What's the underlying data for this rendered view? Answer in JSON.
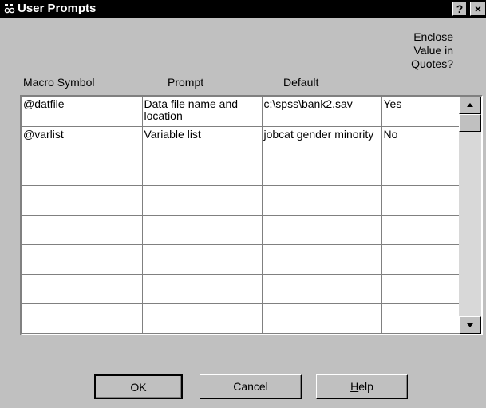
{
  "window": {
    "title": "User Prompts",
    "help_button_label": "?",
    "close_button_label": "×",
    "title_icon": "spss-dialog-icon"
  },
  "columns": {
    "macro_symbol": "Macro Symbol",
    "prompt": "Prompt",
    "default": "Default",
    "enclose_line1": "Enclose",
    "enclose_line2": "Value in",
    "enclose_line3": "Quotes?"
  },
  "rows": [
    {
      "macro": "@datfile",
      "prompt": "Data file name and location",
      "default": "c:\\spss\\bank2.sav",
      "enclose": "Yes"
    },
    {
      "macro": "@varlist",
      "prompt": "Variable list",
      "default": "jobcat gender minority",
      "enclose": "No"
    },
    {
      "macro": "",
      "prompt": "",
      "default": "",
      "enclose": ""
    },
    {
      "macro": "",
      "prompt": "",
      "default": "",
      "enclose": ""
    },
    {
      "macro": "",
      "prompt": "",
      "default": "",
      "enclose": ""
    },
    {
      "macro": "",
      "prompt": "",
      "default": "",
      "enclose": ""
    },
    {
      "macro": "",
      "prompt": "",
      "default": "",
      "enclose": ""
    },
    {
      "macro": "",
      "prompt": "",
      "default": "",
      "enclose": ""
    }
  ],
  "buttons": {
    "ok": "OK",
    "cancel": "Cancel",
    "help_mnemonic": "H",
    "help_rest": "elp"
  },
  "scrollbar": {
    "up_icon": "scroll-up-arrow-icon",
    "down_icon": "scroll-down-arrow-icon"
  }
}
